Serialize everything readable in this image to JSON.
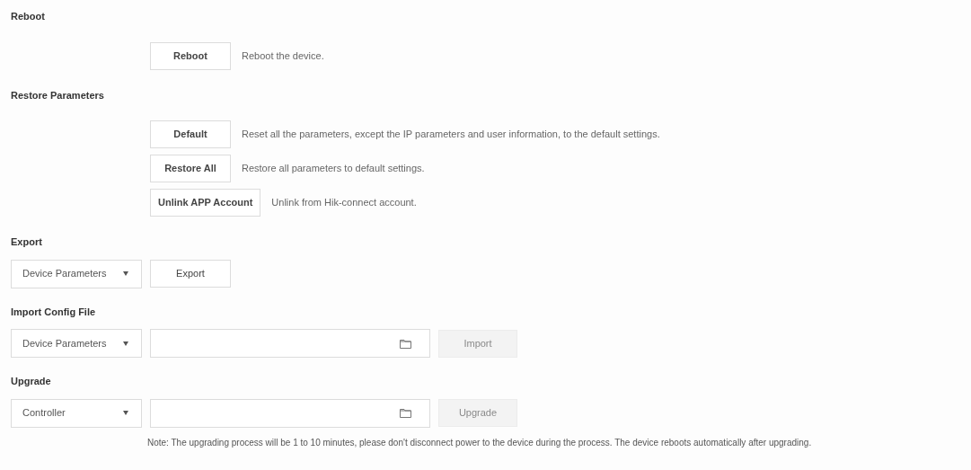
{
  "sections": [
    {
      "kind": "actions",
      "title": "Reboot",
      "actions": [
        {
          "button": "Reboot",
          "description": "Reboot the device."
        }
      ]
    },
    {
      "kind": "actions",
      "title": "Restore Parameters",
      "actions": [
        {
          "button": "Default",
          "description": "Reset all the parameters, except the IP parameters and user information, to the default settings."
        },
        {
          "button": "Restore All",
          "description": "Restore all parameters to default settings."
        },
        {
          "button": "Unlink APP Account",
          "description": "Unlink from Hik-connect account."
        }
      ]
    },
    {
      "kind": "export",
      "title": "Export",
      "select": "Device Parameters",
      "button": {
        "label": "Export",
        "disabled": false
      }
    },
    {
      "kind": "file",
      "title": "Import Config File",
      "select": "Device Parameters",
      "button": {
        "label": "Import",
        "disabled": true
      }
    },
    {
      "kind": "file",
      "title": "Upgrade",
      "select": "Controller",
      "button": {
        "label": "Upgrade",
        "disabled": true
      },
      "note": "Note: The upgrading process will be 1 to 10 minutes, please don't disconnect power to the device during the process. The device reboots automatically after upgrading."
    }
  ]
}
